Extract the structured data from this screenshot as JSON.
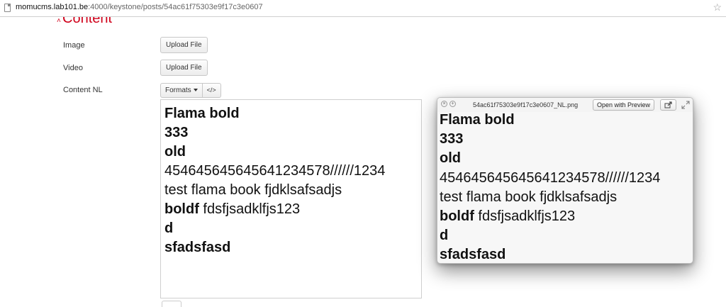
{
  "browser": {
    "url_host": "momucms.lab101.be",
    "url_rest": ":4000/keystone/posts/54ac61f75303e9f17c3e0607"
  },
  "section": {
    "heading": "Content"
  },
  "fields": {
    "image_label": "Image",
    "image_button": "Upload File",
    "video_label": "Video",
    "video_button": "Upload File",
    "content_label": "Content NL"
  },
  "toolbar": {
    "formats_label": "Formats",
    "code_label": "</>"
  },
  "editor": {
    "lines": [
      {
        "bold": "Flama bold",
        "normal": ""
      },
      {
        "bold": "333",
        "normal": ""
      },
      {
        "bold": "old",
        "normal": ""
      },
      {
        "bold": "",
        "normal": "454645645645641234578//////1234"
      },
      {
        "bold": "",
        "normal": "test flama book fjdklsafsadjs"
      },
      {
        "bold": " boldf",
        "normal": " fdsfjsadklfjs123"
      },
      {
        "bold": "d",
        "normal": ""
      },
      {
        "bold": "sfadsfasd",
        "normal": ""
      }
    ]
  },
  "preview": {
    "filename": "54ac61f75303e9f17c3e0607_NL.png",
    "open_button": "Open with Preview",
    "lines": [
      {
        "bold": "Flama bold",
        "normal": ""
      },
      {
        "bold": "333",
        "normal": ""
      },
      {
        "bold": "old",
        "normal": ""
      },
      {
        "bold": "",
        "normal": "454645645645641234578//////1234"
      },
      {
        "bold": "",
        "normal": "test flama book fjdklsafsadjs"
      },
      {
        "bold": " boldf",
        "normal": " fdsfjsadklfjs123"
      },
      {
        "bold": "d",
        "normal": ""
      },
      {
        "bold": "sfadsfasd",
        "normal": ""
      }
    ]
  },
  "colors": {
    "heading": "#d0021b",
    "text": "#111111"
  }
}
